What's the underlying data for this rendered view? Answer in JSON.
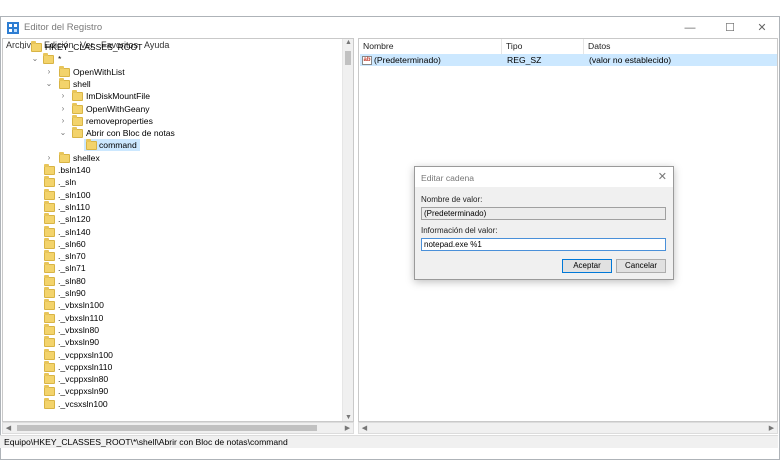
{
  "window": {
    "title": "Editor del Registro",
    "min": "—",
    "max": "☐",
    "close": "✕"
  },
  "menu": [
    "Archivo",
    "Edición",
    "Ver",
    "Favoritos",
    "Ayuda"
  ],
  "tree": {
    "root": "HKEY_CLASSES_ROOT",
    "star": "*",
    "openwithlist": "OpenWithList",
    "shell": "shell",
    "imdiskmountfile": "ImDiskMountFile",
    "openwithgeany": "OpenWithGeany",
    "removeproperties": "removeproperties",
    "abrir": "Abrir con Bloc de notas",
    "command": "command",
    "shellex": "shellex",
    "rest": [
      ".bsln140",
      "._sln",
      "._sln100",
      "._sln110",
      "._sln120",
      "._sln140",
      "._sln60",
      "._sln70",
      "._sln71",
      "._sln80",
      "._sln90",
      "._vbxsln100",
      "._vbxsln110",
      "._vbxsln80",
      "._vbxsln90",
      "._vcppxsln100",
      "._vcppxsln110",
      "._vcppxsln80",
      "._vcppxsln90",
      "._vcsxsln100"
    ]
  },
  "list": {
    "headers": {
      "name": "Nombre",
      "type": "Tipo",
      "data": "Datos"
    },
    "rows": [
      {
        "icon": "ab",
        "name": "(Predeterminado)",
        "type": "REG_SZ",
        "data": "(valor no establecido)"
      }
    ]
  },
  "status": "Equipo\\HKEY_CLASSES_ROOT\\*\\shell\\Abrir con Bloc de notas\\command",
  "dialog": {
    "title": "Editar cadena",
    "close": "✕",
    "name_label": "Nombre de valor:",
    "name_value": "(Predeterminado)",
    "data_label": "Información del valor:",
    "data_value": "notepad.exe %1",
    "ok": "Aceptar",
    "cancel": "Cancelar"
  }
}
